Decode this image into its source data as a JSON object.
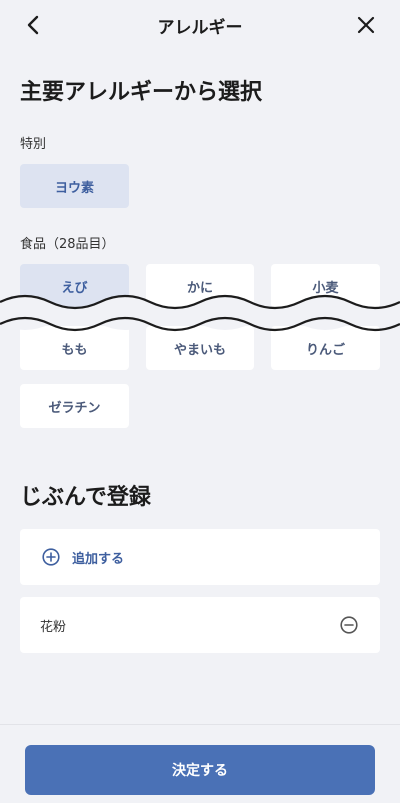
{
  "header": {
    "title": "アレルギー",
    "back_icon": "chevron-left-icon",
    "close_icon": "close-icon"
  },
  "main": {
    "heading": "主要アレルギーから選択",
    "special": {
      "label": "特別",
      "chips": [
        {
          "label": "ヨウ素",
          "selected": true
        }
      ]
    },
    "foods": {
      "label": "食品（28品目）",
      "chips_row1": [
        {
          "label": "えび",
          "selected": true
        },
        {
          "label": "かに",
          "selected": false
        },
        {
          "label": "小麦",
          "selected": false
        }
      ],
      "chips_row2": [
        {
          "label": "もも",
          "selected": false
        },
        {
          "label": "やまいも",
          "selected": false
        },
        {
          "label": "りんご",
          "selected": false
        }
      ],
      "chips_row3": [
        {
          "label": "ゼラチン",
          "selected": false
        }
      ]
    }
  },
  "custom": {
    "heading": "じぶんで登録",
    "add_label": "追加する",
    "add_icon": "plus-circle-icon",
    "items": [
      {
        "label": "花粉",
        "remove_icon": "minus-circle-icon"
      }
    ]
  },
  "footer": {
    "submit_label": "決定する"
  },
  "colors": {
    "background": "#f1f2f6",
    "accent": "#4a71b6",
    "chip_selected_bg": "#dde3f1",
    "chip_selected_text": "#3e5f9f"
  }
}
